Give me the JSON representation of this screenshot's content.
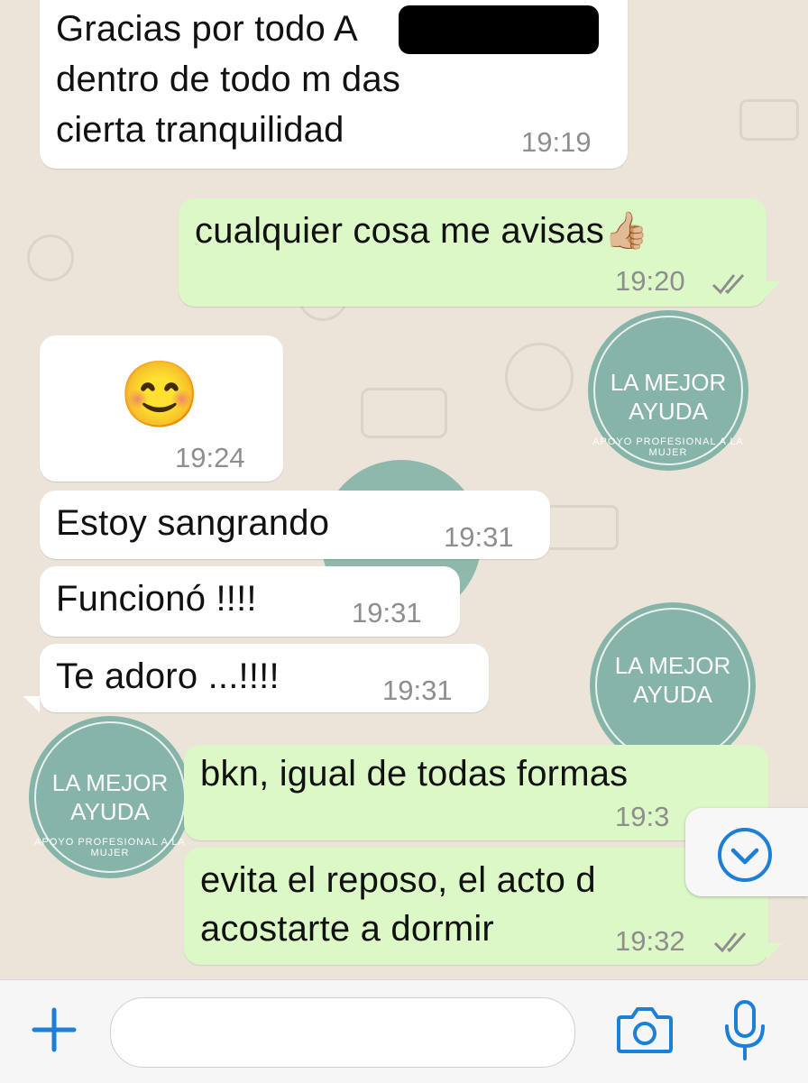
{
  "colors": {
    "incoming": "#ffffff",
    "outgoing": "#dcf8c6",
    "accent": "#1d7fd6",
    "stamp": "#7fb1a5"
  },
  "messages": [
    {
      "dir": "in",
      "lines": [
        "Gracias por todo A",
        "dentro de todo m das",
        "cierta tranquilidad"
      ],
      "time": "19:19"
    },
    {
      "dir": "out",
      "text": "cualquier cosa me avisas👍🏼",
      "time": "19:20",
      "status": "read"
    },
    {
      "dir": "in",
      "text": "😊",
      "time": "19:24"
    },
    {
      "dir": "in",
      "text": "Estoy sangrando",
      "time": "19:31"
    },
    {
      "dir": "in",
      "text": "Funcionó !!!!",
      "time": "19:31"
    },
    {
      "dir": "in",
      "text": "Te adoro ...!!!!",
      "time": "19:31"
    },
    {
      "dir": "out",
      "text": "bkn, igual de todas formas",
      "time": "19:3"
    },
    {
      "dir": "out",
      "lines": [
        "evita el reposo, el acto d",
        "acostarte a dormir"
      ],
      "time": "19:32",
      "status": "read"
    }
  ],
  "watermark": {
    "line1": "LA MEJOR",
    "line2": "AYUDA",
    "ring_text": "APOYO PROFESIONAL A LA MUJER"
  },
  "composer": {
    "placeholder": "",
    "icons": [
      "plus-icon",
      "camera-icon",
      "microphone-icon"
    ]
  },
  "scroll_button_icon": "chevron-down-icon"
}
